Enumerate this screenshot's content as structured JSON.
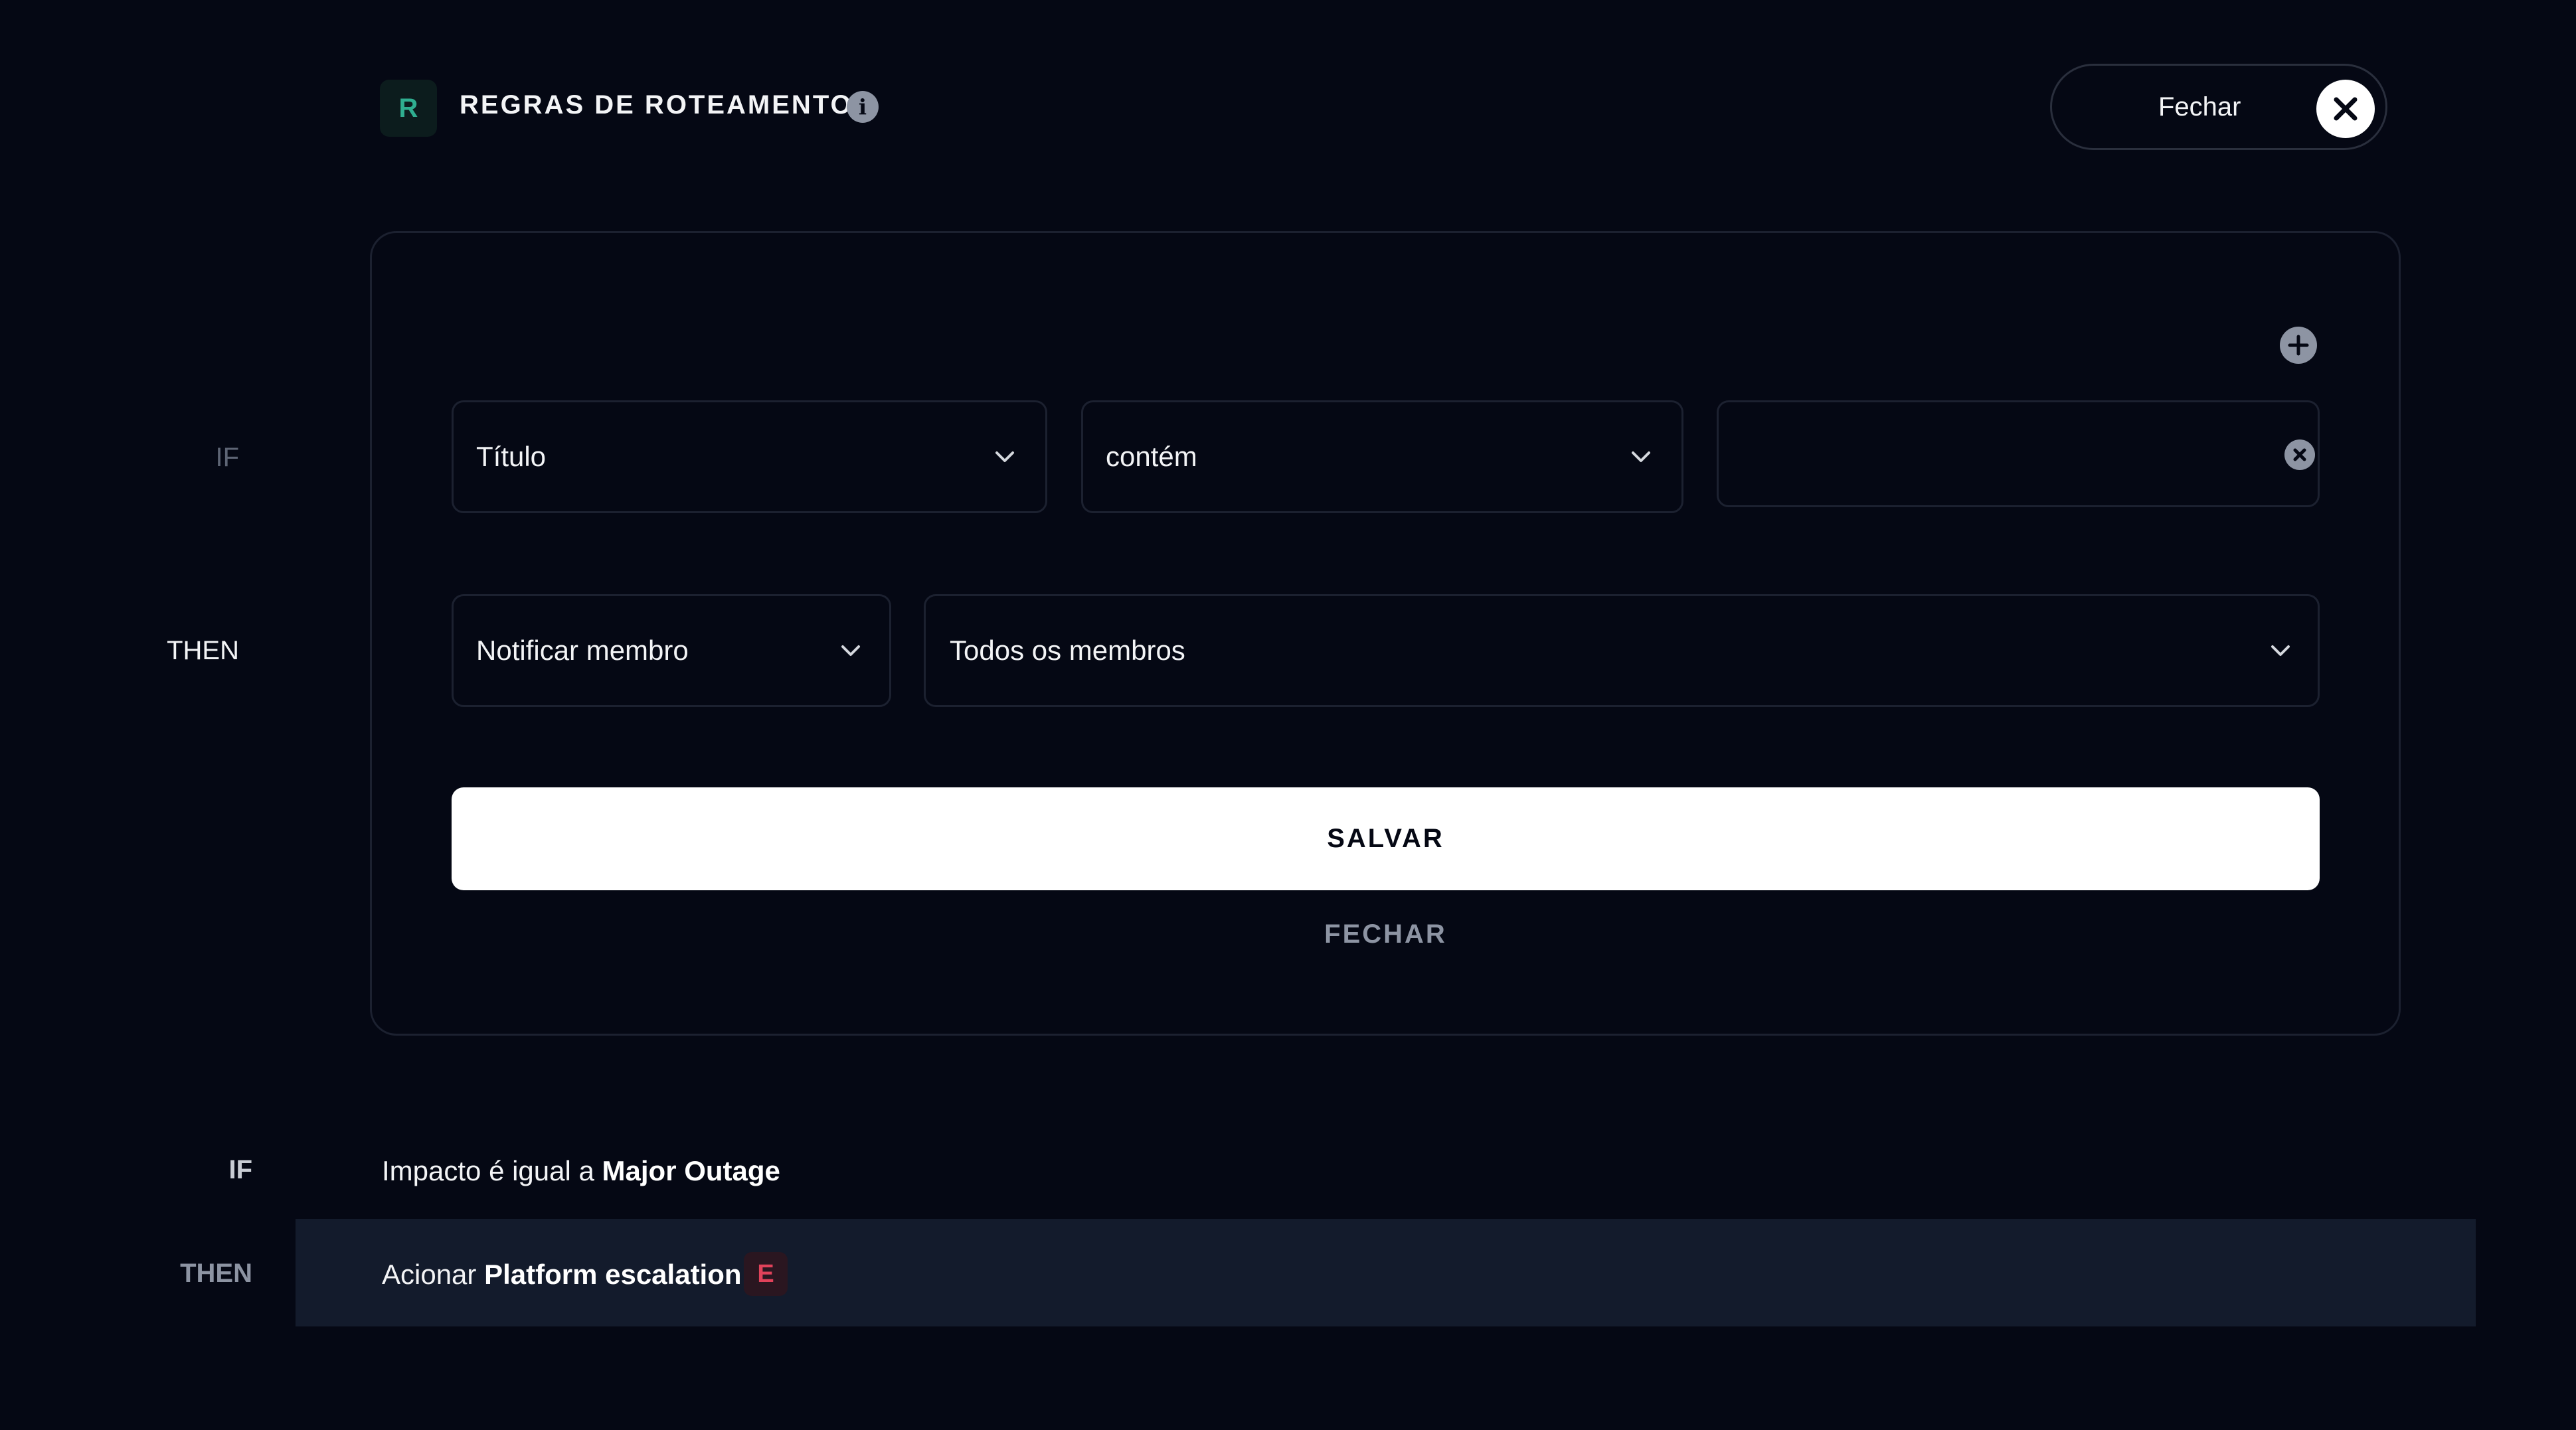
{
  "header": {
    "logo_letter": "R",
    "title": "REGRAS DE ROTEAMENTO",
    "info_icon": "info-icon",
    "close_label": "Fechar",
    "close_icon": "close-icon"
  },
  "editor": {
    "add_icon": "plus-circle-icon",
    "if_label": "IF",
    "then_label": "THEN",
    "condition_field": "Título",
    "condition_operator": "contém",
    "condition_value": "",
    "clear_icon": "clear-circle-icon",
    "action_type": "Notificar membro",
    "action_target": "Todos os membros",
    "save_label": "SALVAR",
    "close_label": "FECHAR"
  },
  "rule": {
    "if_label": "IF",
    "then_label": "THEN",
    "condition_prefix": "Impacto é igual a",
    "condition_value": "Major Outage",
    "action_prefix": "Acionar",
    "action_value": "Platform escalation",
    "badge_letter": "E"
  },
  "colors": {
    "background": "#050814",
    "border": "#1c2130",
    "muted": "#8d94a3",
    "accent_green": "#2fae90",
    "badge_red": "#e0425a",
    "rule_highlight": "#131b2c"
  }
}
